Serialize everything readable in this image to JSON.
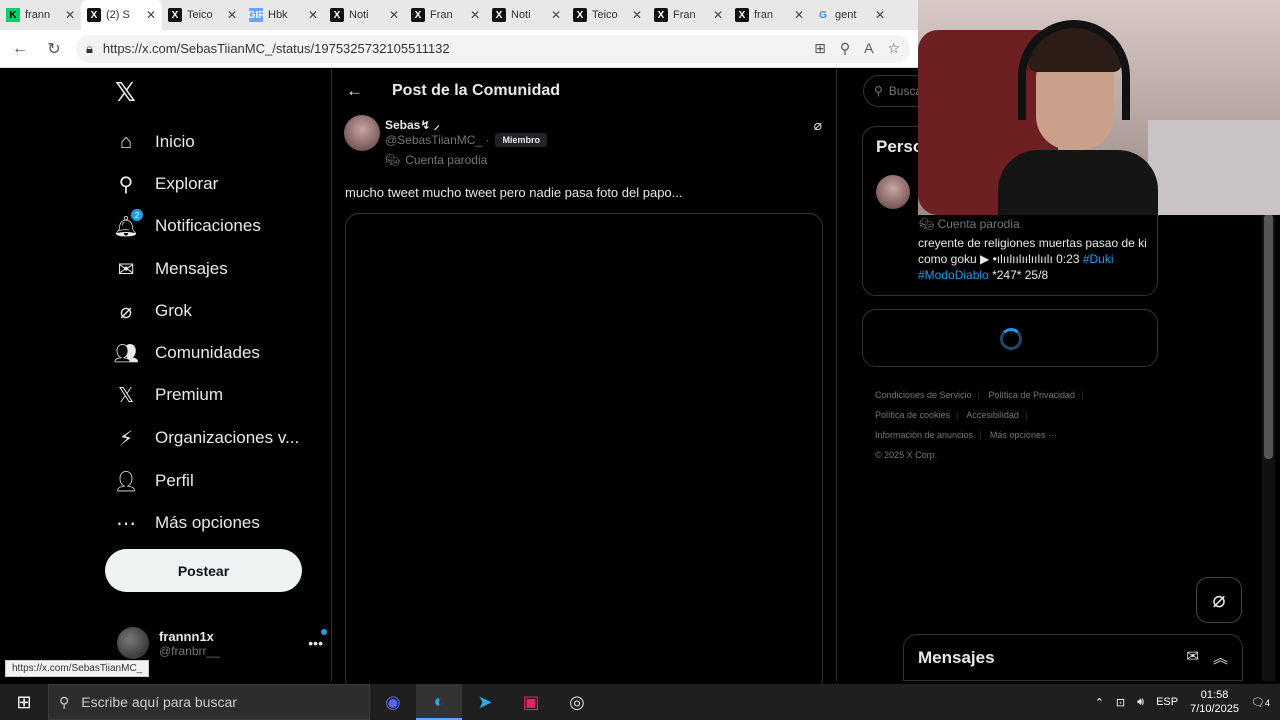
{
  "browser": {
    "tabs": [
      {
        "favicon": "k-icon",
        "title": "frann"
      },
      {
        "favicon": "x-icon",
        "title": "(2) S",
        "active": true
      },
      {
        "favicon": "x-icon",
        "title": "Teico"
      },
      {
        "favicon": "gif-icon",
        "title": "Hbk"
      },
      {
        "favicon": "x-icon",
        "title": "Noti"
      },
      {
        "favicon": "x-icon",
        "title": "Fran"
      },
      {
        "favicon": "x-icon",
        "title": "Noti"
      },
      {
        "favicon": "x-icon",
        "title": "Teico"
      },
      {
        "favicon": "x-icon",
        "title": "Fran"
      },
      {
        "favicon": "x-icon",
        "title": "fran"
      },
      {
        "favicon": "google-icon",
        "title": "gent"
      }
    ],
    "url": "https://x.com/SebasTiianMC_/status/1975325732105511132",
    "status_url": "https://x.com/SebasTiianMC_"
  },
  "nav": {
    "items": [
      {
        "label": "Inicio",
        "icon": "home-icon"
      },
      {
        "label": "Explorar",
        "icon": "search-icon"
      },
      {
        "label": "Notificaciones",
        "icon": "bell-icon",
        "badge": "2"
      },
      {
        "label": "Mensajes",
        "icon": "mail-icon"
      },
      {
        "label": "Grok",
        "icon": "grok-icon"
      },
      {
        "label": "Comunidades",
        "icon": "people-icon"
      },
      {
        "label": "Premium",
        "icon": "x-icon"
      },
      {
        "label": "Organizaciones v...",
        "icon": "lightning-icon"
      },
      {
        "label": "Perfil",
        "icon": "person-icon"
      },
      {
        "label": "Más opciones",
        "icon": "more-icon"
      }
    ],
    "post_button": "Postear",
    "account": {
      "name": "frannn1x",
      "handle": "@franbrr__"
    }
  },
  "post": {
    "header": "Post de la Comunidad",
    "author_name": "Sebas↯ ⸝",
    "author_handle": "@SebasTiianMC_ ·",
    "member_badge": "Miembro",
    "parody_label": "Cuenta parodia",
    "text": "mucho tweet mucho tweet pero nadie pasa foto del papo..."
  },
  "sidebar": {
    "search_placeholder": "Busca",
    "card_title": "Perso",
    "parody_label": "Cuenta parodia",
    "bio_main": "creyente de religiones muertas pasao de ki como goku ▶ •ılıılıılıılıılıılı 0:23",
    "bio_tags": [
      "#Duki",
      "#ModoDiablo"
    ],
    "bio_tail": "*247* 25/8",
    "footer": {
      "terms": "Condiciones de Servicio",
      "privacy": "Política de Privacidad",
      "cookies": "Política de cookies",
      "accessibility": "Accesibilidad",
      "ads": "Información de anuncios",
      "more": "Más opciones ···",
      "copyright": "© 2025 X Corp."
    },
    "messages_label": "Mensajes"
  },
  "taskbar": {
    "search_placeholder": "Escribe aquí para buscar",
    "language": "ESP",
    "time": "01:58",
    "date": "7/10/2025",
    "notification_count": "4"
  },
  "colors": {
    "accent": "#1d9bf0",
    "background": "#000000",
    "text": "#e7e9ea",
    "muted": "#71767b"
  }
}
